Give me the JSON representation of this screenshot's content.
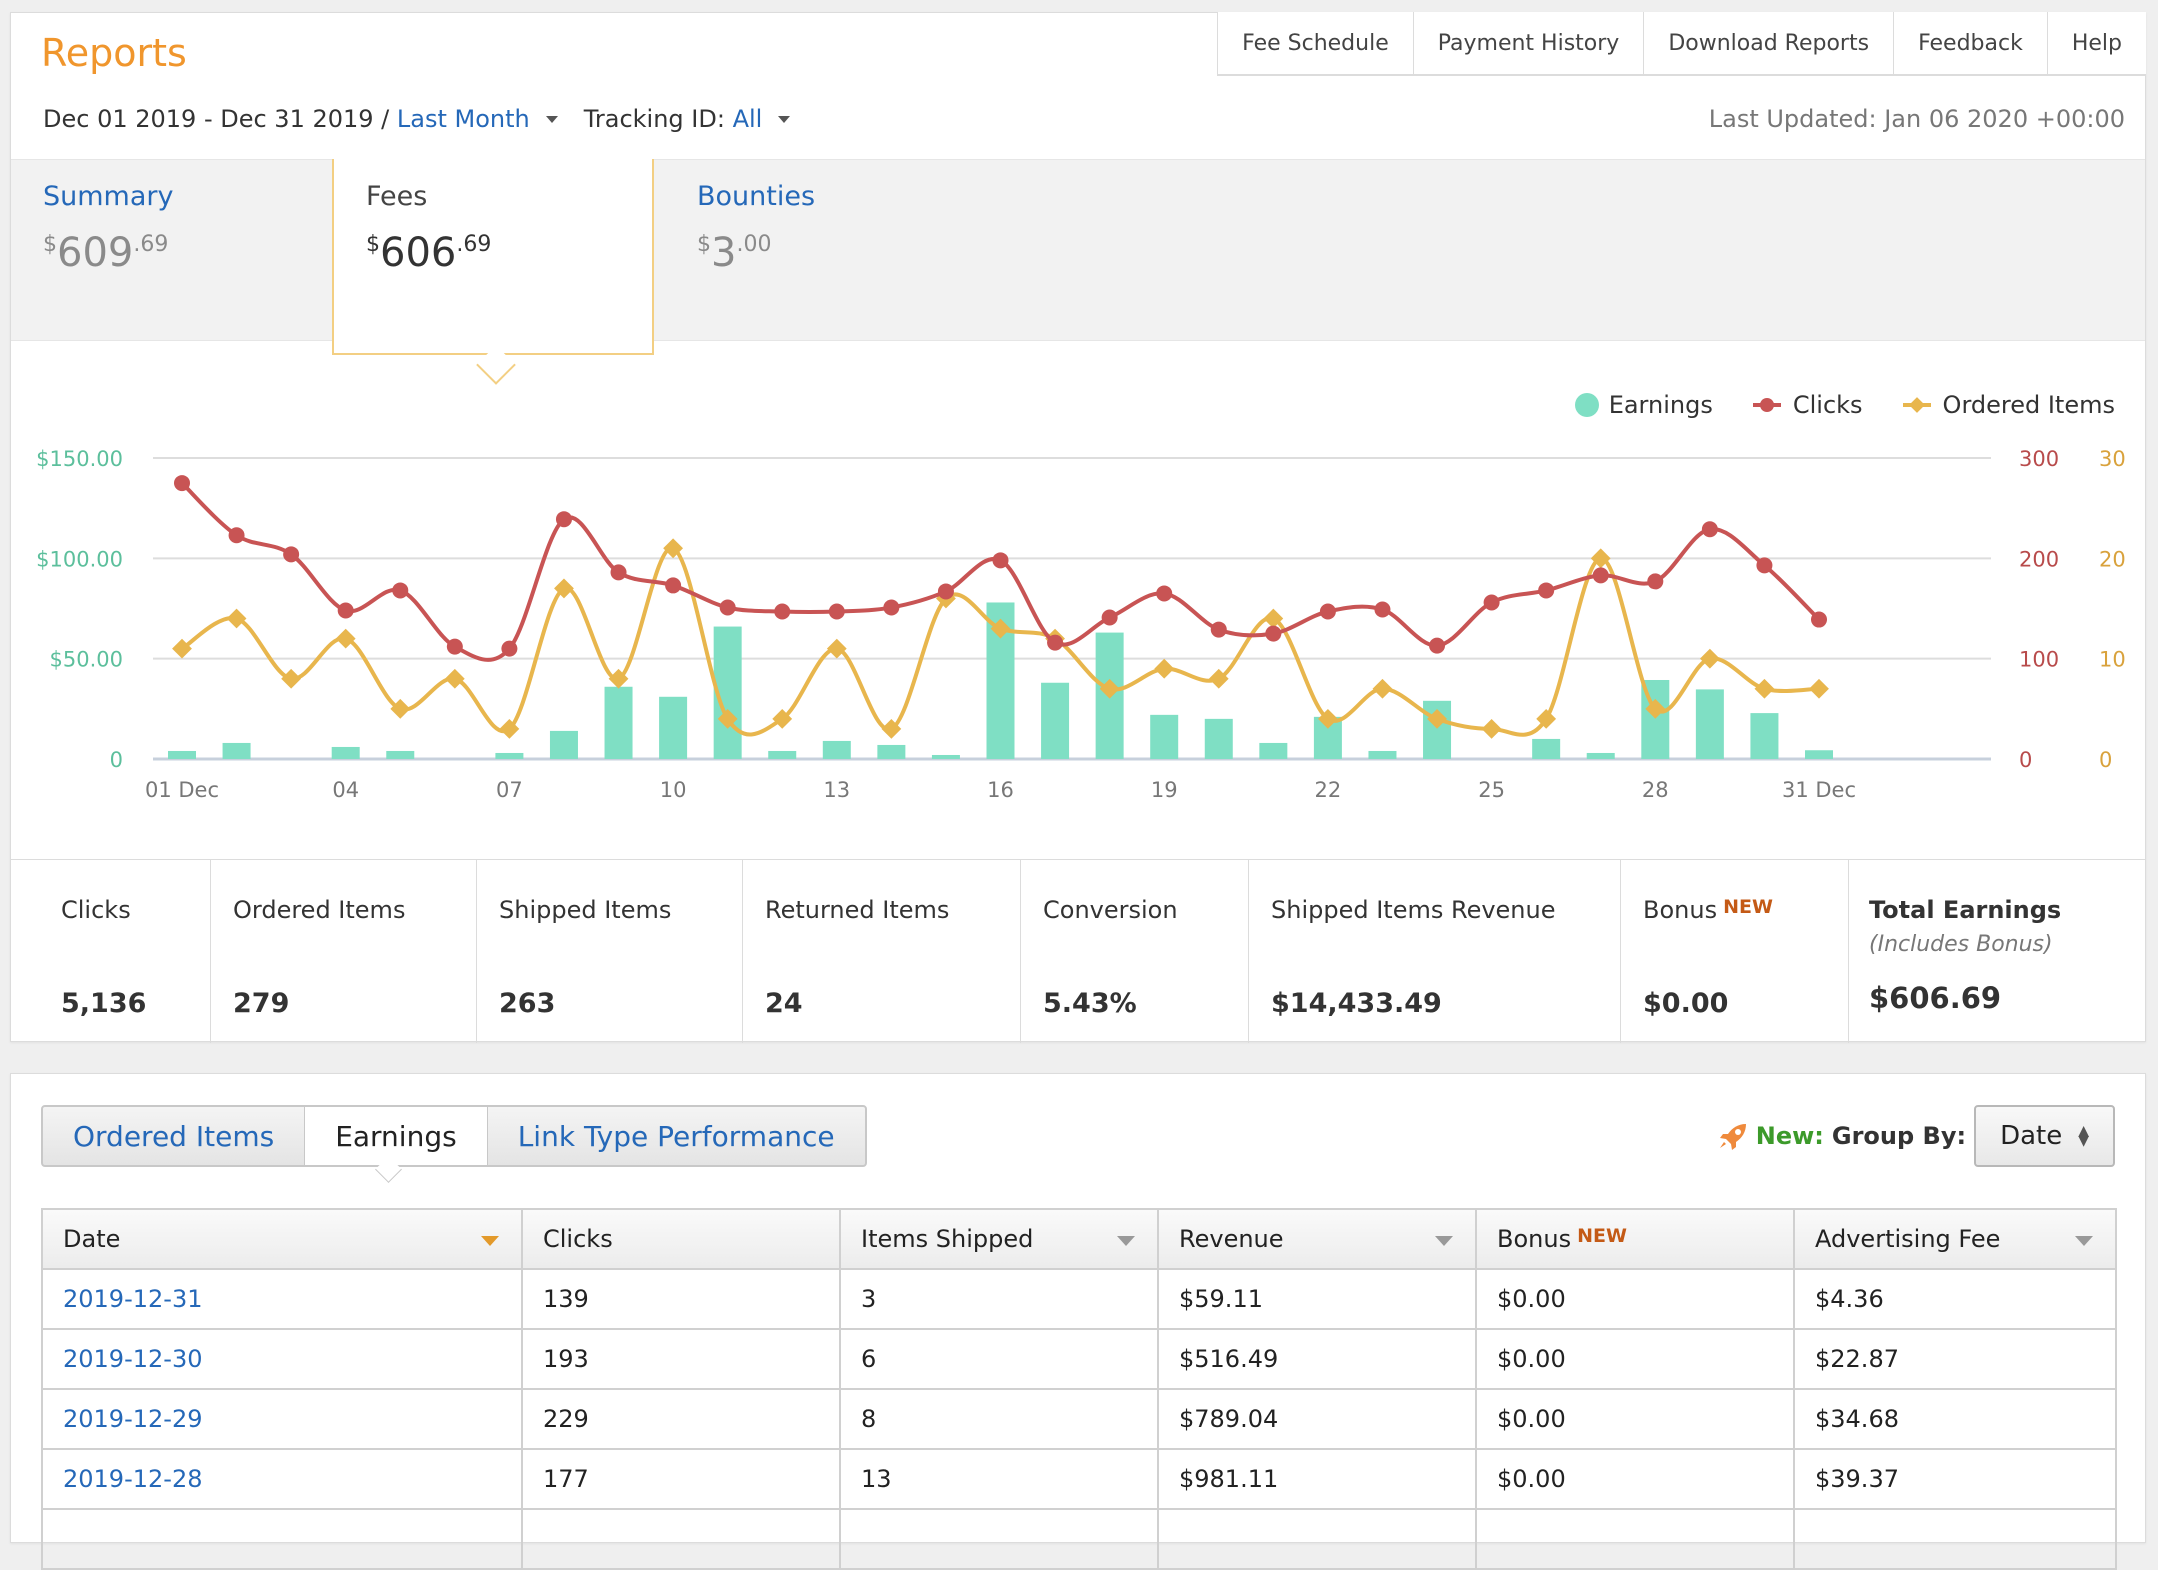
{
  "header": {
    "title": "Reports",
    "toolbar": [
      "Fee Schedule",
      "Payment History",
      "Download Reports",
      "Feedback",
      "Help"
    ],
    "date_range": "Dec 01 2019 - Dec 31 2019 /",
    "date_preset": "Last Month",
    "tracking_label": "Tracking ID:",
    "tracking_value": "All",
    "last_updated": "Last Updated: Jan 06 2020 +00:00"
  },
  "summary_tabs": [
    {
      "label": "Summary",
      "currency": "$",
      "whole": "609",
      "cents": ".69",
      "active": false
    },
    {
      "label": "Fees",
      "currency": "$",
      "whole": "606",
      "cents": ".69",
      "active": true
    },
    {
      "label": "Bounties",
      "currency": "$",
      "whole": "3",
      "cents": ".00",
      "active": false
    }
  ],
  "legend": [
    "Earnings",
    "Clicks",
    "Ordered Items"
  ],
  "colors": {
    "earnings": "#7fdfc4",
    "clicks": "#c85454",
    "ordered_items": "#e8b64d",
    "accent_orange": "#f0962d",
    "link_blue": "#2568b8",
    "new_badge": "#c45a16",
    "new_green": "#3c9a2a"
  },
  "chart_data": {
    "type": "bar+line",
    "x": [
      "01",
      "02",
      "03",
      "04",
      "05",
      "06",
      "07",
      "08",
      "09",
      "10",
      "11",
      "12",
      "13",
      "14",
      "15",
      "16",
      "17",
      "18",
      "19",
      "20",
      "21",
      "22",
      "23",
      "24",
      "25",
      "26",
      "27",
      "28",
      "29",
      "30",
      "31"
    ],
    "x_tick_labels": [
      "01 Dec",
      "04",
      "07",
      "10",
      "13",
      "16",
      "19",
      "22",
      "25",
      "28",
      "31 Dec"
    ],
    "x_tick_days": [
      1,
      4,
      7,
      10,
      13,
      16,
      19,
      22,
      25,
      28,
      31
    ],
    "series": [
      {
        "name": "Earnings",
        "type": "bar",
        "axis": "left",
        "values": [
          4,
          8,
          0,
          6,
          4,
          0,
          3,
          14,
          36,
          31,
          66,
          4,
          9,
          7,
          2,
          78,
          38,
          63,
          22,
          20,
          8,
          21,
          4,
          29,
          0,
          10,
          3,
          39.37,
          34.68,
          22.87,
          4.36
        ]
      },
      {
        "name": "Clicks",
        "type": "line",
        "axis": "right1",
        "values": [
          275,
          223,
          204,
          148,
          168,
          112,
          110,
          239,
          186,
          173,
          151,
          147,
          147,
          151,
          167,
          198,
          116,
          141,
          165,
          129,
          125,
          147,
          149,
          113,
          156,
          168,
          183,
          177,
          229,
          193,
          139
        ]
      },
      {
        "name": "Ordered Items",
        "type": "line",
        "axis": "right2",
        "values": [
          11,
          14,
          8,
          12,
          5,
          8,
          3,
          17,
          8,
          21,
          4,
          4,
          11,
          3,
          16,
          13,
          12,
          7,
          9,
          8,
          14,
          4,
          7,
          4,
          3,
          4,
          20,
          5,
          10,
          7,
          7
        ]
      }
    ],
    "left_axis": {
      "ticks": [
        "0",
        "$50.00",
        "$100.00",
        "$150.00"
      ],
      "range": [
        0,
        150
      ]
    },
    "right_axis_1": {
      "ticks": [
        "0",
        "100",
        "200",
        "300"
      ],
      "range": [
        0,
        300
      ]
    },
    "right_axis_2": {
      "ticks": [
        "0",
        "10",
        "20",
        "30"
      ],
      "range": [
        0,
        30
      ]
    },
    "grid": true,
    "legend_position": "top-right"
  },
  "stats": [
    {
      "label": "Clicks",
      "value": "5,136"
    },
    {
      "label": "Ordered Items",
      "value": "279"
    },
    {
      "label": "Shipped Items",
      "value": "263"
    },
    {
      "label": "Returned Items",
      "value": "24"
    },
    {
      "label": "Conversion",
      "value": "5.43%"
    },
    {
      "label": "Shipped Items Revenue",
      "value": "$14,433.49"
    },
    {
      "label": "Bonus",
      "badge": "NEW",
      "value": "$0.00"
    },
    {
      "label": "Total Earnings",
      "sub": "(Includes Bonus)",
      "value": "$606.69"
    }
  ],
  "report_tabs": [
    {
      "label": "Ordered Items",
      "active": false
    },
    {
      "label": "Earnings",
      "active": true
    },
    {
      "label": "Link Type Performance",
      "active": false
    }
  ],
  "group_by": {
    "new_label": "New:",
    "label": "Group By:",
    "value": "Date"
  },
  "table": {
    "columns": [
      {
        "label": "Date",
        "sort": "active"
      },
      {
        "label": "Clicks",
        "sort": "none"
      },
      {
        "label": "Items Shipped",
        "sort": "available"
      },
      {
        "label": "Revenue",
        "sort": "available"
      },
      {
        "label": "Bonus",
        "badge": "NEW",
        "sort": "none"
      },
      {
        "label": "Advertising Fee",
        "sort": "available"
      }
    ],
    "rows": [
      [
        "2019-12-31",
        "139",
        "3",
        "$59.11",
        "$0.00",
        "$4.36"
      ],
      [
        "2019-12-30",
        "193",
        "6",
        "$516.49",
        "$0.00",
        "$22.87"
      ],
      [
        "2019-12-29",
        "229",
        "8",
        "$789.04",
        "$0.00",
        "$34.68"
      ],
      [
        "2019-12-28",
        "177",
        "13",
        "$981.11",
        "$0.00",
        "$39.37"
      ],
      [
        "",
        "",
        "",
        "",
        "",
        ""
      ]
    ]
  }
}
